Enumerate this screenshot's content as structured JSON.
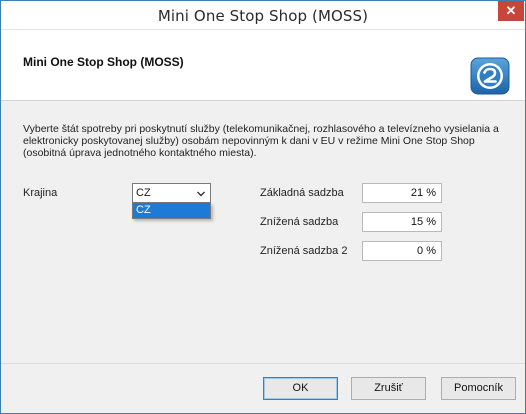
{
  "window": {
    "title": "Mini One Stop Shop (MOSS)",
    "close_label": "✕"
  },
  "header": {
    "title": "Mini One Stop Shop (MOSS)",
    "logo_icon": "logo-icon"
  },
  "description": "Vyberte štát spotreby pri poskytnutí služby (telekomunikačnej, rozhlasového a televízneho vysielania a elektronicky poskytovanej služby) osobám nepovinným k dani v EU v režime Mini One Stop Shop (osobitná úprava jednotného kontaktného miesta).",
  "country": {
    "label": "Krajina",
    "selected": "CZ",
    "options": [
      "CZ"
    ]
  },
  "rates": [
    {
      "label": "Základná sadzba",
      "value": "21 %"
    },
    {
      "label": "Znížená sadzba",
      "value": "15 %"
    },
    {
      "label": "Znížená sadzba 2",
      "value": "0 %"
    }
  ],
  "buttons": {
    "ok": "OK",
    "cancel": "Zrušiť",
    "help": "Pomocník"
  },
  "colors": {
    "selection": "#1e7ad6",
    "close": "#c7453a",
    "logo": "#2f7fc4"
  }
}
